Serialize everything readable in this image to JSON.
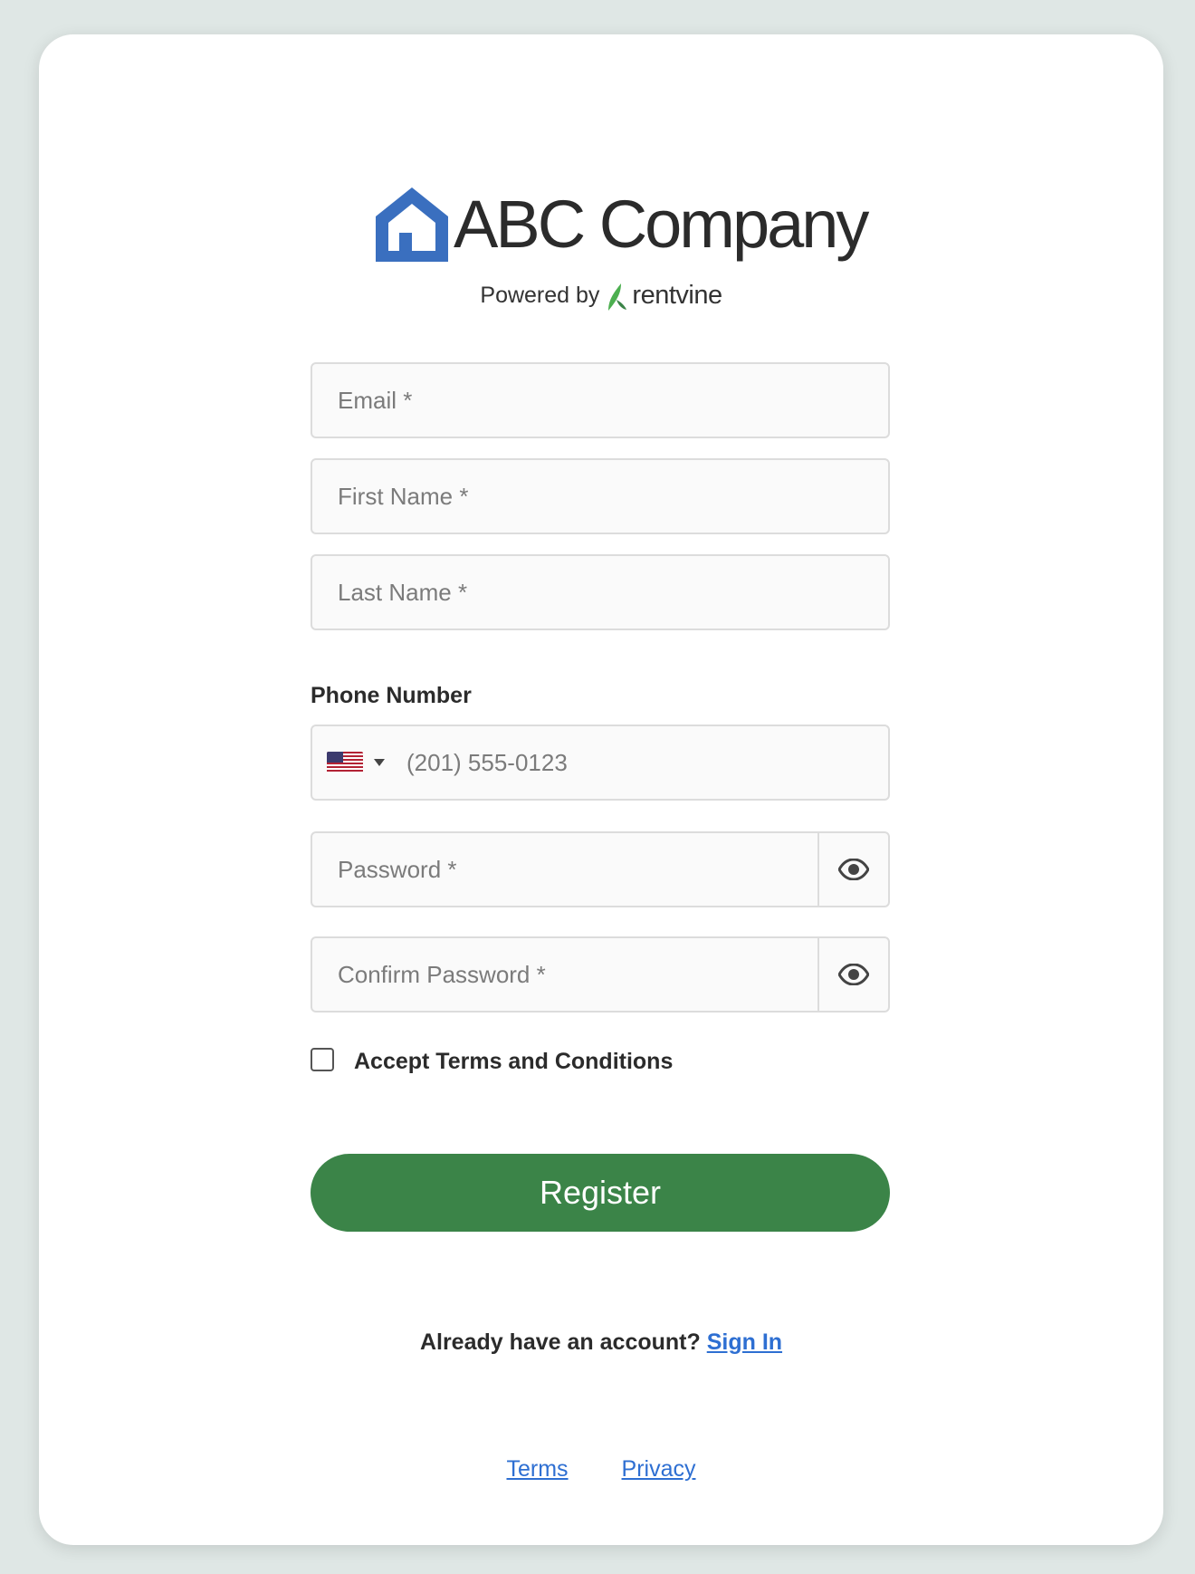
{
  "brand": {
    "company_name": "ABC Company",
    "powered_by": "Powered by",
    "platform_name": "rentvine",
    "brand_blue": "#3a6fbf",
    "leaf_green": "#4caf50"
  },
  "form": {
    "email_placeholder": "Email *",
    "first_name_placeholder": "First Name *",
    "last_name_placeholder": "Last Name *",
    "phone_label": "Phone Number",
    "phone_country": "us-flag-icon",
    "phone_placeholder": "(201) 555-0123",
    "password_placeholder": "Password *",
    "confirm_password_placeholder": "Confirm Password *",
    "terms_label": "Accept Terms and Conditions",
    "terms_checked": false,
    "register_label": "Register",
    "register_color": "#3b8448"
  },
  "signin": {
    "prompt": "Already have an account?",
    "link_label": "Sign In"
  },
  "footer": {
    "terms_label": "Terms",
    "privacy_label": "Privacy"
  }
}
